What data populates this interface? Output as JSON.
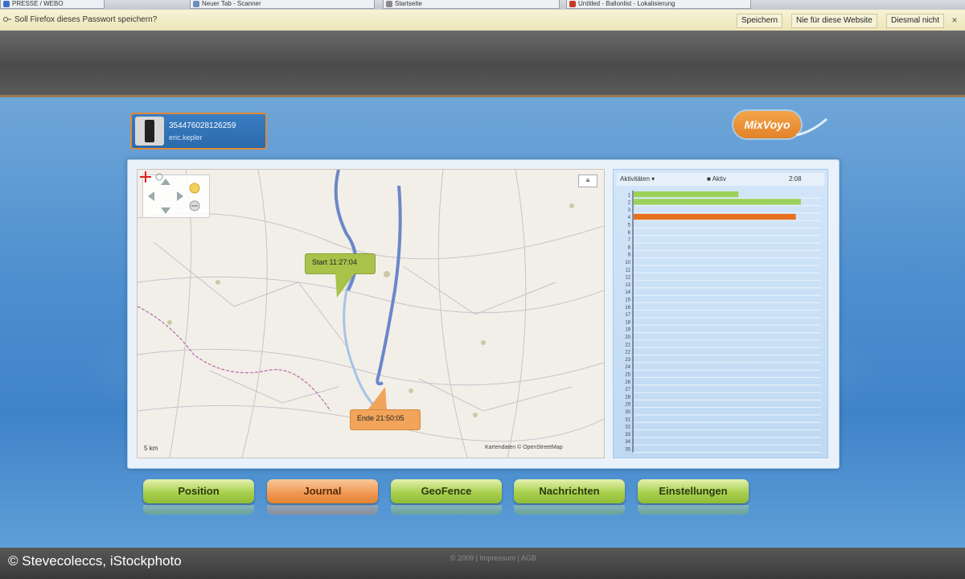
{
  "browser": {
    "tabs": [
      "PRESSE / WEBO",
      "Neuer Tab - Scanner",
      "Startseite",
      "Untitled - Ballonlist - Lokalisierung"
    ],
    "notification": {
      "message": "Soll Firefox dieses Passwort speichern?",
      "buttons": [
        "Speichern",
        "Nie für diese Website",
        "Diesmal nicht"
      ],
      "close": "×"
    }
  },
  "device": {
    "id_line": "354476028126259",
    "name_line": "eric.kepler"
  },
  "logo": {
    "text": "MixVoyo"
  },
  "map": {
    "start_label": "Start 11:27:04",
    "end_label": "Ende 21:50:05",
    "scale": "5 km",
    "attribution": "Kartendaten © OpenStreetMap",
    "toggle": "≡"
  },
  "chart_data": {
    "type": "bar",
    "orientation": "horizontal",
    "header_left": "Aktivitäten ▾",
    "header_mid": "■ Aktiv",
    "header_right": "2:08",
    "categories": [
      "1",
      "2",
      "3",
      "4",
      "5",
      "6",
      "7",
      "8",
      "9",
      "10",
      "11",
      "12",
      "13",
      "14",
      "15",
      "16",
      "17",
      "18",
      "19",
      "20",
      "21",
      "22",
      "23",
      "24",
      "25",
      "26",
      "27",
      "28",
      "29",
      "30",
      "31",
      "32",
      "33",
      "34",
      "35"
    ],
    "series": [
      {
        "values": [
          0.62,
          0.99,
          0,
          0.96,
          0,
          0,
          0,
          0,
          0,
          0,
          0,
          0,
          0,
          0,
          0,
          0,
          0,
          0,
          0,
          0,
          0,
          0,
          0,
          0,
          0,
          0,
          0,
          0,
          0,
          0,
          0,
          0,
          0,
          0,
          0
        ],
        "colors": [
          "#9bd15a",
          "#9bd15a",
          "#9bd15a",
          "#e8711f"
        ]
      }
    ],
    "xlim": [
      0,
      1
    ]
  },
  "nav": {
    "tabs": [
      {
        "label": "Position",
        "style": "green"
      },
      {
        "label": "Journal",
        "style": "orange"
      },
      {
        "label": "GeoFence",
        "style": "green"
      },
      {
        "label": "Nachrichten",
        "style": "green"
      },
      {
        "label": "Einstellungen",
        "style": "green"
      }
    ]
  },
  "footer": {
    "text": "© 2009 | Impressum | AGB"
  },
  "credit": "© Stevecoleccs, iStockphoto",
  "colors": {
    "accent_orange": "#e8711f",
    "accent_green": "#9bd15a",
    "panel_blue": "#4e8fcf"
  }
}
